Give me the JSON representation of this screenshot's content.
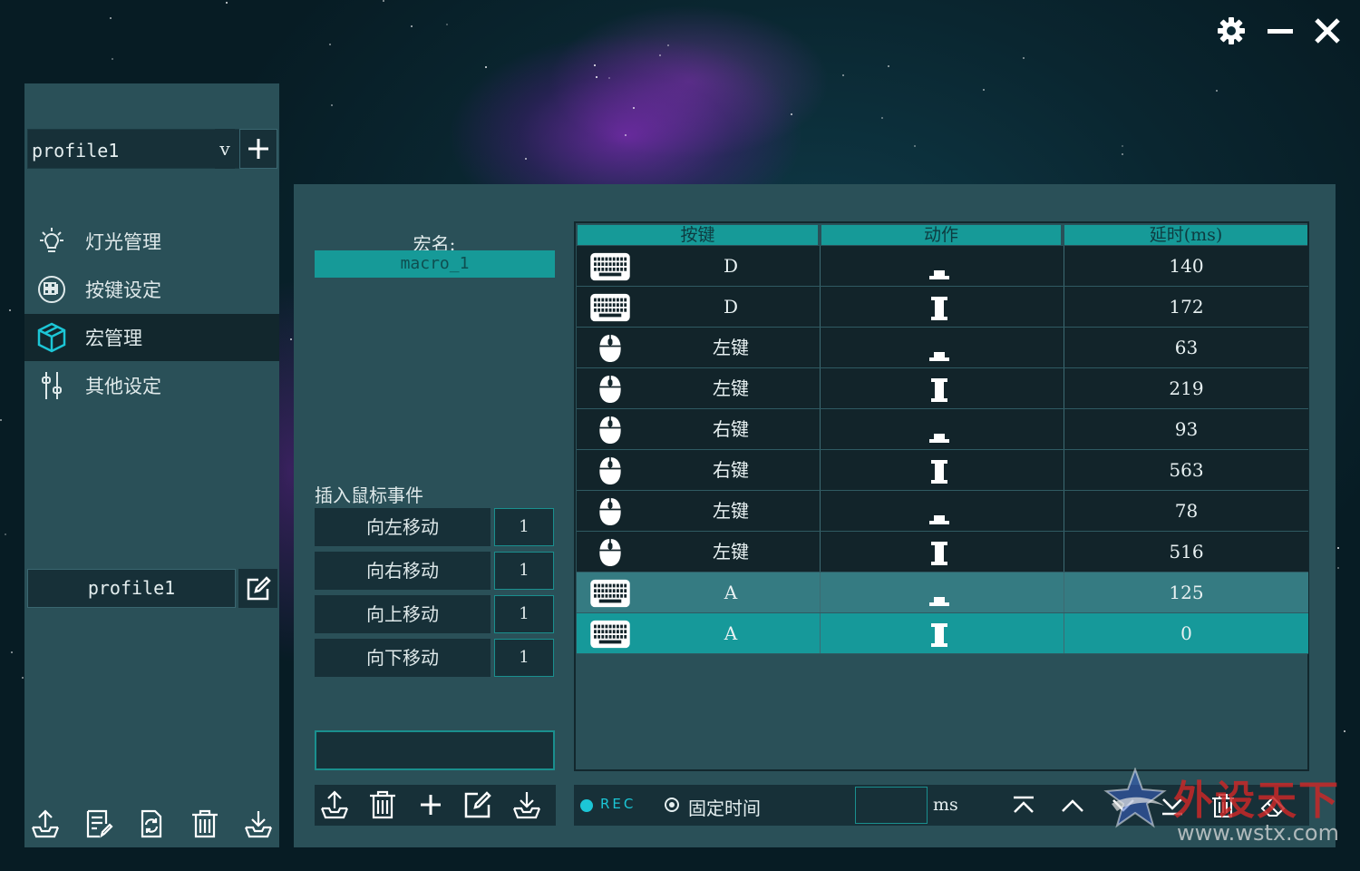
{
  "window": {
    "settings_icon": "gear-icon",
    "minimize_icon": "minimize-icon",
    "close_icon": "close-icon"
  },
  "sidebar": {
    "profile_select": "profile1",
    "dropdown_label": "v",
    "nav": [
      {
        "label": "灯光管理",
        "icon": "light-bulb-icon",
        "active": false
      },
      {
        "label": "按键设定",
        "icon": "keypad-icon",
        "active": false
      },
      {
        "label": "宏管理",
        "icon": "cube-icon",
        "active": true
      },
      {
        "label": "其他设定",
        "icon": "sliders-icon",
        "active": false
      }
    ],
    "profile_name": "profile1"
  },
  "macro": {
    "name_label": "宏名:",
    "name_value": "macro_1"
  },
  "mouse_events": {
    "title": "插入鼠标事件",
    "items": [
      {
        "label": "向左移动",
        "value": "1"
      },
      {
        "label": "向右移动",
        "value": "1"
      },
      {
        "label": "向上移动",
        "value": "1"
      },
      {
        "label": "向下移动",
        "value": "1"
      }
    ]
  },
  "table": {
    "headers": [
      "按键",
      "动作",
      "延时(ms)"
    ],
    "rows": [
      {
        "device": "keyboard",
        "key": "D",
        "action": "press",
        "delay": "140",
        "state": "normal"
      },
      {
        "device": "keyboard",
        "key": "D",
        "action": "release",
        "delay": "172",
        "state": "normal"
      },
      {
        "device": "mouse",
        "key": "左键",
        "action": "press",
        "delay": "63",
        "state": "normal"
      },
      {
        "device": "mouse",
        "key": "左键",
        "action": "release",
        "delay": "219",
        "state": "normal"
      },
      {
        "device": "mouse",
        "key": "右键",
        "action": "press",
        "delay": "93",
        "state": "normal"
      },
      {
        "device": "mouse",
        "key": "右键",
        "action": "release",
        "delay": "563",
        "state": "normal"
      },
      {
        "device": "mouse",
        "key": "左键",
        "action": "press",
        "delay": "78",
        "state": "normal"
      },
      {
        "device": "mouse",
        "key": "左键",
        "action": "release",
        "delay": "516",
        "state": "normal"
      },
      {
        "device": "keyboard",
        "key": "A",
        "action": "press",
        "delay": "125",
        "state": "hover"
      },
      {
        "device": "keyboard",
        "key": "A",
        "action": "release",
        "delay": "0",
        "state": "selected"
      }
    ]
  },
  "bottom_bar": {
    "rec_label": "REC",
    "fixed_time_label": "固定时间",
    "ms_value": "",
    "ms_unit": "ms"
  },
  "watermark": {
    "text": "外设天下",
    "url": "www.wstx.com"
  },
  "colors": {
    "accent": "#169a98",
    "panel": "#2a5058",
    "dark": "#12242a",
    "rec": "#1cc6d6"
  }
}
